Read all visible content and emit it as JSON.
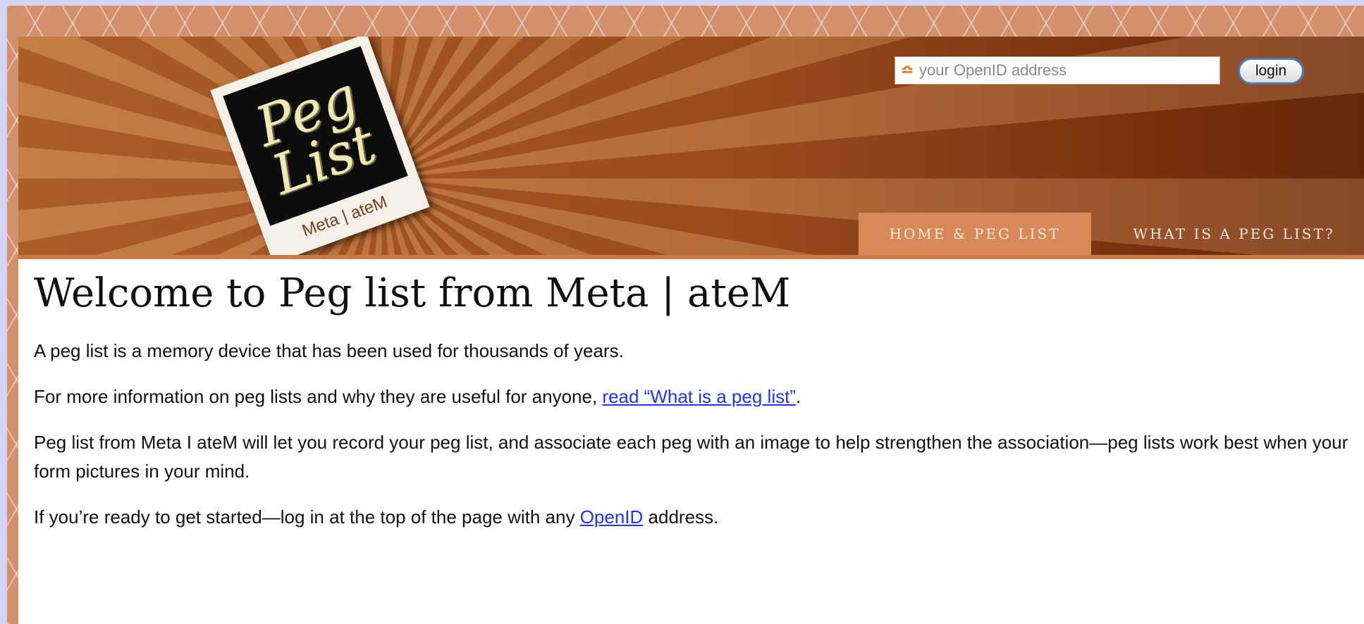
{
  "header": {
    "logo": {
      "word_top": "Peg",
      "word_bottom": "List",
      "caption": "Meta | ateM"
    },
    "openid": {
      "placeholder": "your OpenID address"
    },
    "login_label": "login",
    "nav": [
      {
        "label": "HOME & PEG LIST",
        "active": true
      },
      {
        "label": "WHAT IS A PEG LIST?",
        "active": false
      }
    ]
  },
  "main": {
    "title": "Welcome to Peg list from Meta | ateM",
    "p1": "A peg list is a memory device that has been used for thousands of years.",
    "p2": {
      "before": "For more information on peg lists and why they are useful for anyone, ",
      "link": "read “What is a peg list”",
      "after": "."
    },
    "p3": "Peg list from Meta I ateM will let you record your peg list, and associate each peg with an image to help strengthen the association—peg lists work best when your form pictures in your mind.",
    "p4": {
      "before": "If you’re ready to get started—log in at the top of the page with any ",
      "link": "OpenID",
      "after": " address."
    }
  },
  "colors": {
    "link": "#1f33ff",
    "nav_active_bg": "#d8895a",
    "header_brown": "#a8541f"
  },
  "icons": {
    "openid": "openid-logo-icon"
  }
}
